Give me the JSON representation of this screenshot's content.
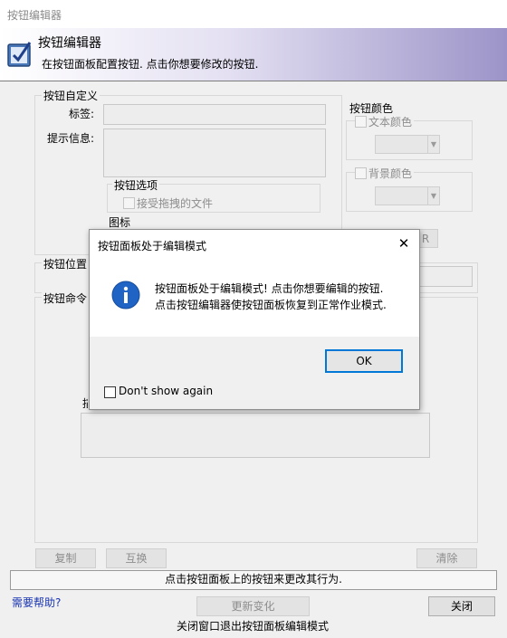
{
  "window": {
    "title": "按钮编辑器"
  },
  "header": {
    "title": "按钮编辑器",
    "subtitle": "在按钮面板配置按钮. 点击你想要修改的按钮."
  },
  "custom": {
    "group_label": "按钮自定义",
    "label_label": "标签:",
    "label_value": "",
    "tooltip_label": "提示信息:",
    "tooltip_value": "",
    "options_label": "按钮选项",
    "accept_drag": "接受拖拽的文件",
    "icon_label": "图标"
  },
  "color": {
    "group_label": "按钮颜色",
    "text_color": "文本颜色",
    "bg_color": "背景颜色",
    "r_button": "R"
  },
  "position": {
    "group_label": "按钮位置"
  },
  "command": {
    "group_label": "按钮命令"
  },
  "actions": {
    "copy": "复制",
    "swap": "互换",
    "clear": "清除"
  },
  "status_text": "点击按钮面板上的按钮来更改其行为.",
  "help_link": "需要帮助?",
  "update_button": "更新变化",
  "close_button": "关闭",
  "footer_note": "关闭窗口退出按钮面板编辑模式",
  "dialog": {
    "title": "按钮面板处于编辑模式",
    "line1": "按钮面板处于编辑模式! 点击你想要编辑的按钮.",
    "line2": "点击按钮编辑器使按钮面板恢复到正常作业模式.",
    "ok": "OK",
    "dont_show": "Don't show again"
  }
}
